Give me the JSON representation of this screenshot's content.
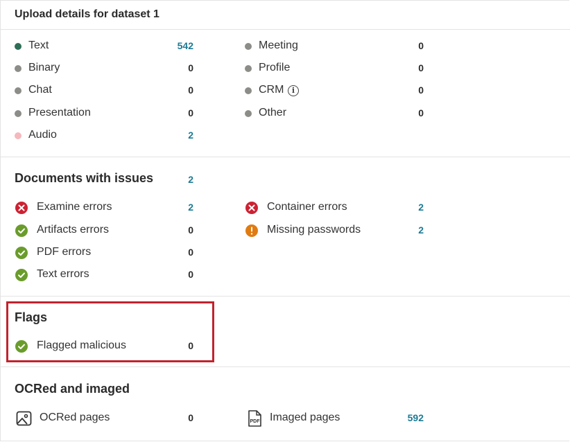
{
  "header": {
    "title": "Upload details for dataset 1"
  },
  "colors": {
    "text_dot": "#2e6e57",
    "grey_dot": "#8c8c88",
    "audio_dot": "#f4b8bd",
    "error_red": "#cc2233",
    "ok_green": "#6a9c2b",
    "warn_orange": "#e07b12",
    "link_blue": "#1c7a93",
    "highlight_border": "#c0232e"
  },
  "types": {
    "left": [
      {
        "label": "Text",
        "count": "542",
        "dot": "text_dot"
      },
      {
        "label": "Binary",
        "count": "0",
        "dot": "grey_dot"
      },
      {
        "label": "Chat",
        "count": "0",
        "dot": "grey_dot"
      },
      {
        "label": "Presentation",
        "count": "0",
        "dot": "grey_dot"
      },
      {
        "label": "Audio",
        "count": "2",
        "dot": "audio_dot"
      }
    ],
    "right": [
      {
        "label": "Meeting",
        "count": "0",
        "dot": "grey_dot"
      },
      {
        "label": "Profile",
        "count": "0",
        "dot": "grey_dot"
      },
      {
        "label": "CRM",
        "count": "0",
        "dot": "grey_dot",
        "info_icon": "info-icon"
      },
      {
        "label": "Other",
        "count": "0",
        "dot": "grey_dot"
      }
    ]
  },
  "issues": {
    "title": "Documents with issues",
    "count": "2",
    "left": [
      {
        "label": "Examine errors",
        "count": "2",
        "status": "error"
      },
      {
        "label": "Artifacts errors",
        "count": "0",
        "status": "ok"
      },
      {
        "label": "PDF errors",
        "count": "0",
        "status": "ok"
      },
      {
        "label": "Text errors",
        "count": "0",
        "status": "ok"
      }
    ],
    "right": [
      {
        "label": "Container errors",
        "count": "2",
        "status": "error"
      },
      {
        "label": "Missing passwords",
        "count": "2",
        "status": "warning"
      }
    ]
  },
  "flags": {
    "title": "Flags",
    "items": [
      {
        "label": "Flagged malicious",
        "count": "0",
        "status": "ok"
      }
    ]
  },
  "ocr": {
    "title": "OCRed and imaged",
    "items": [
      {
        "label": "OCRed pages",
        "count": "0",
        "icon": "image-icon"
      },
      {
        "label": "Imaged pages",
        "count": "592",
        "icon": "pdf-icon",
        "icon_text": "PDF"
      }
    ]
  }
}
